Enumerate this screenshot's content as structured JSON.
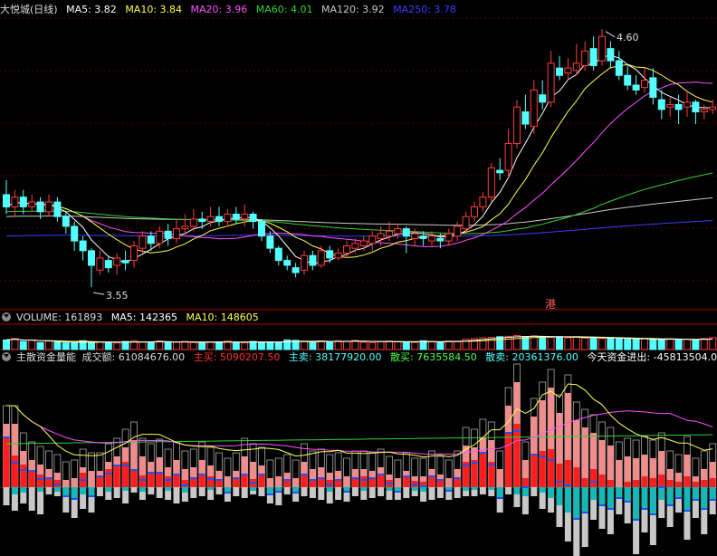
{
  "colors": {
    "background": "#000000",
    "up": "#ff3c3c",
    "down": "#54ffff",
    "ma5": "#ffffff",
    "ma10": "#ffff50",
    "ma20": "#ff50ff",
    "ma60": "#32d232",
    "ma120": "#c8c8c8",
    "ma250": "#3c3cff",
    "separator": "#b00000",
    "main_buy": "#ff1e1e",
    "main_sell": "#16b7b7",
    "retail_buy": "#f08c8c",
    "retail_sell": "#c8c8c8",
    "net_flow": "#2050ff"
  },
  "price_header": {
    "icon": "chevron-down-icon",
    "title": "大悦城(日线)",
    "ma5": "MA5: 3.82",
    "ma10": "MA10: 3.84",
    "ma20": "MA20: 3.96",
    "ma60": "MA60: 4.01",
    "ma120": "MA120: 3.92",
    "ma250": "MA250: 3.78"
  },
  "volume_header": {
    "icon": "chevron-down-icon",
    "volume": "VOLUME: 161893",
    "ma5": "MA5: 142365",
    "ma10": "MA10: 148605"
  },
  "flow_header": {
    "icon": "chevron-down-icon",
    "title": "主散资金量能",
    "turnover": "成交额: 61084676.00",
    "main_buy": "主买: 5090207.50",
    "main_sell": "主卖: 38177920.00",
    "retail_buy": "散买: 7635584.50",
    "retail_sell": "散卖: 20361376.00",
    "net_flow": "今天资金进出: -45813504.00"
  },
  "annotations": {
    "high": "4.60",
    "low": "3.55",
    "hk_marker": "港"
  },
  "chart_data": [
    {
      "type": "candlestick",
      "title": "大悦城(日线)",
      "ylim": [
        3.48,
        4.67
      ],
      "high_label": 4.6,
      "low_label": 3.55,
      "candles": [
        [
          3.93,
          3.88,
          3.99,
          3.85
        ],
        [
          3.88,
          3.92,
          3.95,
          3.84
        ],
        [
          3.92,
          3.88,
          3.95,
          3.85
        ],
        [
          3.88,
          3.9,
          3.93,
          3.86
        ],
        [
          3.9,
          3.86,
          3.92,
          3.83
        ],
        [
          3.86,
          3.9,
          3.93,
          3.84
        ],
        [
          3.9,
          3.84,
          3.92,
          3.82
        ],
        [
          3.84,
          3.8,
          3.86,
          3.77
        ],
        [
          3.8,
          3.74,
          3.82,
          3.7
        ],
        [
          3.74,
          3.7,
          3.76,
          3.66
        ],
        [
          3.7,
          3.64,
          3.71,
          3.55
        ],
        [
          3.62,
          3.67,
          3.7,
          3.6
        ],
        [
          3.66,
          3.63,
          3.68,
          3.61
        ],
        [
          3.64,
          3.67,
          3.69,
          3.6
        ],
        [
          3.66,
          3.65,
          3.7,
          3.62
        ],
        [
          3.66,
          3.72,
          3.74,
          3.63
        ],
        [
          3.71,
          3.76,
          3.78,
          3.69
        ],
        [
          3.76,
          3.73,
          3.78,
          3.7
        ],
        [
          3.73,
          3.78,
          3.8,
          3.71
        ],
        [
          3.78,
          3.75,
          3.81,
          3.72
        ],
        [
          3.75,
          3.79,
          3.83,
          3.73
        ],
        [
          3.79,
          3.8,
          3.85,
          3.77
        ],
        [
          3.8,
          3.83,
          3.87,
          3.78
        ],
        [
          3.83,
          3.82,
          3.86,
          3.79
        ],
        [
          3.82,
          3.84,
          3.88,
          3.8
        ],
        [
          3.84,
          3.82,
          3.88,
          3.8
        ],
        [
          3.82,
          3.85,
          3.87,
          3.8
        ],
        [
          3.85,
          3.83,
          3.88,
          3.81
        ],
        [
          3.83,
          3.85,
          3.89,
          3.8
        ],
        [
          3.85,
          3.82,
          3.86,
          3.79
        ],
        [
          3.82,
          3.76,
          3.83,
          3.74
        ],
        [
          3.76,
          3.71,
          3.78,
          3.69
        ],
        [
          3.71,
          3.66,
          3.72,
          3.64
        ],
        [
          3.66,
          3.64,
          3.68,
          3.62
        ],
        [
          3.63,
          3.61,
          3.65,
          3.59
        ],
        [
          3.62,
          3.68,
          3.7,
          3.6
        ],
        [
          3.68,
          3.64,
          3.7,
          3.62
        ],
        [
          3.64,
          3.7,
          3.72,
          3.63
        ],
        [
          3.7,
          3.67,
          3.72,
          3.65
        ],
        [
          3.67,
          3.69,
          3.71,
          3.66
        ],
        [
          3.69,
          3.72,
          3.74,
          3.67
        ],
        [
          3.71,
          3.73,
          3.75,
          3.69
        ],
        [
          3.72,
          3.74,
          3.76,
          3.7
        ],
        [
          3.73,
          3.76,
          3.78,
          3.7
        ],
        [
          3.75,
          3.77,
          3.8,
          3.72
        ],
        [
          3.76,
          3.78,
          3.82,
          3.74
        ],
        [
          3.77,
          3.79,
          3.81,
          3.75
        ],
        [
          3.79,
          3.76,
          3.8,
          3.69
        ],
        [
          3.75,
          3.77,
          3.79,
          3.72
        ],
        [
          3.76,
          3.75,
          3.78,
          3.72
        ],
        [
          3.74,
          3.76,
          3.78,
          3.72
        ],
        [
          3.75,
          3.74,
          3.77,
          3.71
        ],
        [
          3.74,
          3.77,
          3.79,
          3.72
        ],
        [
          3.76,
          3.8,
          3.82,
          3.74
        ],
        [
          3.79,
          3.84,
          3.86,
          3.77
        ],
        [
          3.84,
          3.88,
          3.9,
          3.82
        ],
        [
          3.88,
          3.92,
          3.94,
          3.86
        ],
        [
          3.92,
          4.04,
          4.06,
          3.9
        ],
        [
          4.03,
          4.02,
          4.08,
          3.99
        ],
        [
          4.03,
          4.14,
          4.2,
          4.0
        ],
        [
          4.14,
          4.29,
          4.32,
          4.12
        ],
        [
          4.27,
          4.22,
          4.34,
          4.2
        ],
        [
          4.21,
          4.36,
          4.4,
          4.18
        ],
        [
          4.34,
          4.31,
          4.4,
          4.28
        ],
        [
          4.31,
          4.47,
          4.52,
          4.29
        ],
        [
          4.45,
          4.42,
          4.5,
          4.4
        ],
        [
          4.43,
          4.45,
          4.49,
          4.4
        ],
        [
          4.44,
          4.47,
          4.55,
          4.42
        ],
        [
          4.46,
          4.52,
          4.56,
          4.44
        ],
        [
          4.53,
          4.46,
          4.58,
          4.44
        ],
        [
          4.48,
          4.58,
          4.61,
          4.46
        ],
        [
          4.53,
          4.48,
          4.56,
          4.45
        ],
        [
          4.48,
          4.42,
          4.52,
          4.4
        ],
        [
          4.42,
          4.38,
          4.46,
          4.36
        ],
        [
          4.38,
          4.36,
          4.42,
          4.34
        ],
        [
          4.37,
          4.4,
          4.45,
          4.35
        ],
        [
          4.41,
          4.33,
          4.45,
          4.3
        ],
        [
          4.32,
          4.28,
          4.36,
          4.24
        ],
        [
          4.29,
          4.3,
          4.33,
          4.25
        ],
        [
          4.3,
          4.28,
          4.34,
          4.22
        ],
        [
          4.29,
          4.31,
          4.36,
          4.25
        ],
        [
          4.31,
          4.27,
          4.32,
          4.22
        ],
        [
          4.27,
          4.28,
          4.3,
          4.24
        ],
        [
          4.28,
          4.29,
          4.32,
          4.26
        ]
      ]
    },
    {
      "type": "bar",
      "title": "VOLUME",
      "ylim": [
        0,
        320000
      ],
      "values": [
        130000,
        150000,
        110000,
        125000,
        95000,
        115000,
        100000,
        90000,
        85000,
        120000,
        100000,
        105000,
        95000,
        90000,
        110000,
        120000,
        105000,
        100000,
        115000,
        95000,
        100000,
        110000,
        95000,
        90000,
        100000,
        105000,
        115000,
        95000,
        90000,
        110000,
        100000,
        105000,
        95000,
        130000,
        125000,
        110000,
        100000,
        115000,
        105000,
        120000,
        110000,
        125000,
        100000,
        95000,
        110000,
        115000,
        105000,
        100000,
        95000,
        120000,
        110000,
        105000,
        115000,
        110000,
        140000,
        150000,
        160000,
        165000,
        175000,
        180000,
        190000,
        175000,
        185000,
        170000,
        165000,
        175000,
        160000,
        170000,
        155000,
        165000,
        150000,
        160000,
        145000,
        140000,
        135000,
        150000,
        140000,
        130000,
        145000,
        135000,
        140000,
        130000,
        150000,
        161893
      ]
    },
    {
      "type": "bar",
      "title": "主散资金量能",
      "series": [
        {
          "name": "主买",
          "values": [
            55,
            35,
            25,
            18,
            14,
            10,
            8,
            0,
            0,
            16,
            0,
            12,
            20,
            24,
            28,
            19,
            13,
            16,
            16,
            12,
            14,
            8,
            10,
            14,
            12,
            8,
            0,
            10,
            14,
            9,
            14,
            0,
            0,
            8,
            0,
            14,
            8,
            10,
            8,
            8,
            0,
            10,
            12,
            10,
            14,
            8,
            0,
            12,
            7,
            6,
            12,
            8,
            0,
            10,
            28,
            30,
            38,
            28,
            0,
            60,
            70,
            10,
            36,
            40,
            42,
            26,
            30,
            22,
            10,
            20,
            14,
            8,
            0,
            6,
            8,
            12,
            10,
            14,
            8,
            6,
            12,
            6,
            8,
            10
          ]
        },
        {
          "name": "主卖",
          "values": [
            0,
            -8,
            -6,
            0,
            -5,
            0,
            -5,
            -10,
            -13,
            -8,
            -10,
            0,
            -5,
            0,
            -4,
            0,
            -5,
            0,
            0,
            -4,
            0,
            -6,
            0,
            0,
            -3,
            0,
            -6,
            0,
            0,
            -4,
            0,
            -8,
            -5,
            0,
            -6,
            0,
            0,
            0,
            -5,
            0,
            -5,
            0,
            -4,
            0,
            0,
            -4,
            -5,
            0,
            -4,
            -5,
            0,
            0,
            -4,
            0,
            -4,
            -3,
            0,
            -3,
            -12,
            0,
            -8,
            -10,
            0,
            -6,
            -12,
            -20,
            -28,
            -35,
            -28,
            -14,
            -20,
            -24,
            -12,
            -16,
            -36,
            -24,
            -30,
            -14,
            -20,
            -12,
            -26,
            -14,
            -24,
            -14
          ]
        },
        {
          "name": "散买",
          "values": [
            70,
            70,
            40,
            30,
            25,
            20,
            16,
            8,
            10,
            22,
            18,
            18,
            28,
            34,
            44,
            52,
            34,
            28,
            33,
            22,
            30,
            20,
            22,
            30,
            24,
            18,
            12,
            18,
            34,
            28,
            24,
            10,
            12,
            16,
            10,
            28,
            20,
            22,
            16,
            18,
            12,
            20,
            20,
            18,
            22,
            14,
            10,
            18,
            12,
            12,
            20,
            14,
            10,
            20,
            46,
            44,
            55,
            52,
            20,
            90,
            116,
            30,
            78,
            96,
            110,
            82,
            104,
            74,
            66,
            60,
            52,
            46,
            30,
            34,
            32,
            36,
            32,
            40,
            20,
            16,
            36,
            12,
            20,
            28
          ]
        },
        {
          "name": "散卖",
          "values": [
            -20,
            -26,
            -18,
            -26,
            -30,
            -8,
            -10,
            -28,
            -34,
            -24,
            -28,
            -10,
            -14,
            -12,
            -18,
            -6,
            -14,
            -8,
            -12,
            -14,
            -18,
            -16,
            -12,
            -10,
            -14,
            -8,
            -16,
            -10,
            -12,
            -8,
            -10,
            -18,
            -20,
            -8,
            -16,
            -10,
            -12,
            -14,
            -18,
            -14,
            -16,
            -10,
            -14,
            -12,
            -10,
            -14,
            -14,
            -12,
            -10,
            -16,
            -14,
            -12,
            -14,
            -12,
            -10,
            -10,
            -8,
            -10,
            -28,
            -8,
            -22,
            -30,
            -10,
            -24,
            -28,
            -44,
            -60,
            -76,
            -66,
            -36,
            -46,
            -52,
            -30,
            -40,
            -74,
            -50,
            -64,
            -34,
            -44,
            -28,
            -58,
            -34,
            -52,
            -30
          ]
        }
      ]
    }
  ]
}
